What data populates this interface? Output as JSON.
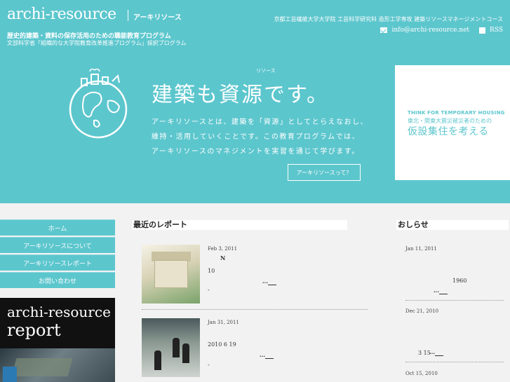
{
  "header": {
    "logo": "archi-resource",
    "logo_kana": "アーキリソース",
    "tagline1": "歴史的建築・資料の保存活用のための職能教育プログラム",
    "tagline2": "文部科学省「組織的な大学院教育改革推進プログラム」採択プログラム",
    "university": "京都工芸繊維大学大学院 工芸科学研究科 造形工学専攻 建築リソースマネージメントコース",
    "email": "info@archi-resource.net",
    "rss": "RSS"
  },
  "hero": {
    "ruby": "リソース",
    "title": "建築も資源です。",
    "body_l1": "アーキリソースとは、建築を「資源」としてとらえなおし、",
    "body_l2": "維持・活用していくことです。この教育プログラムでは、",
    "body_l3": "アーキリソースのマネジメントを実習を通じて学びます。",
    "button": "アーキリソースって？"
  },
  "banner": {
    "en": "THINK FOR TEMPORARY HOUSING",
    "sub": "東北・関東大震災被災者のための",
    "ja": "仮設集住を考える"
  },
  "nav": [
    "ホーム",
    "アーキリソースについて",
    "アーキリソースレポート",
    "お問い合わせ"
  ],
  "report_box": {
    "line1": "archi-resource",
    "line2": "report"
  },
  "main": {
    "section_title": "最近のレポート",
    "reports": [
      {
        "date": "Feb 3, 2011",
        "l1": "N",
        "l2": "10",
        "more": "...",
        "dash": "-"
      },
      {
        "date": "Jan 31, 2011",
        "l1": "2010  6  19",
        "more": "...",
        "dash": "-"
      }
    ]
  },
  "news": {
    "section_title": "おしらせ",
    "items": [
      {
        "date": "Jan 11, 2011",
        "text": "1960",
        "more": "..."
      },
      {
        "date": "Dec 21, 2010",
        "text": "3  15",
        "more": "..."
      },
      {
        "date": "Oct 15, 2010"
      }
    ]
  }
}
